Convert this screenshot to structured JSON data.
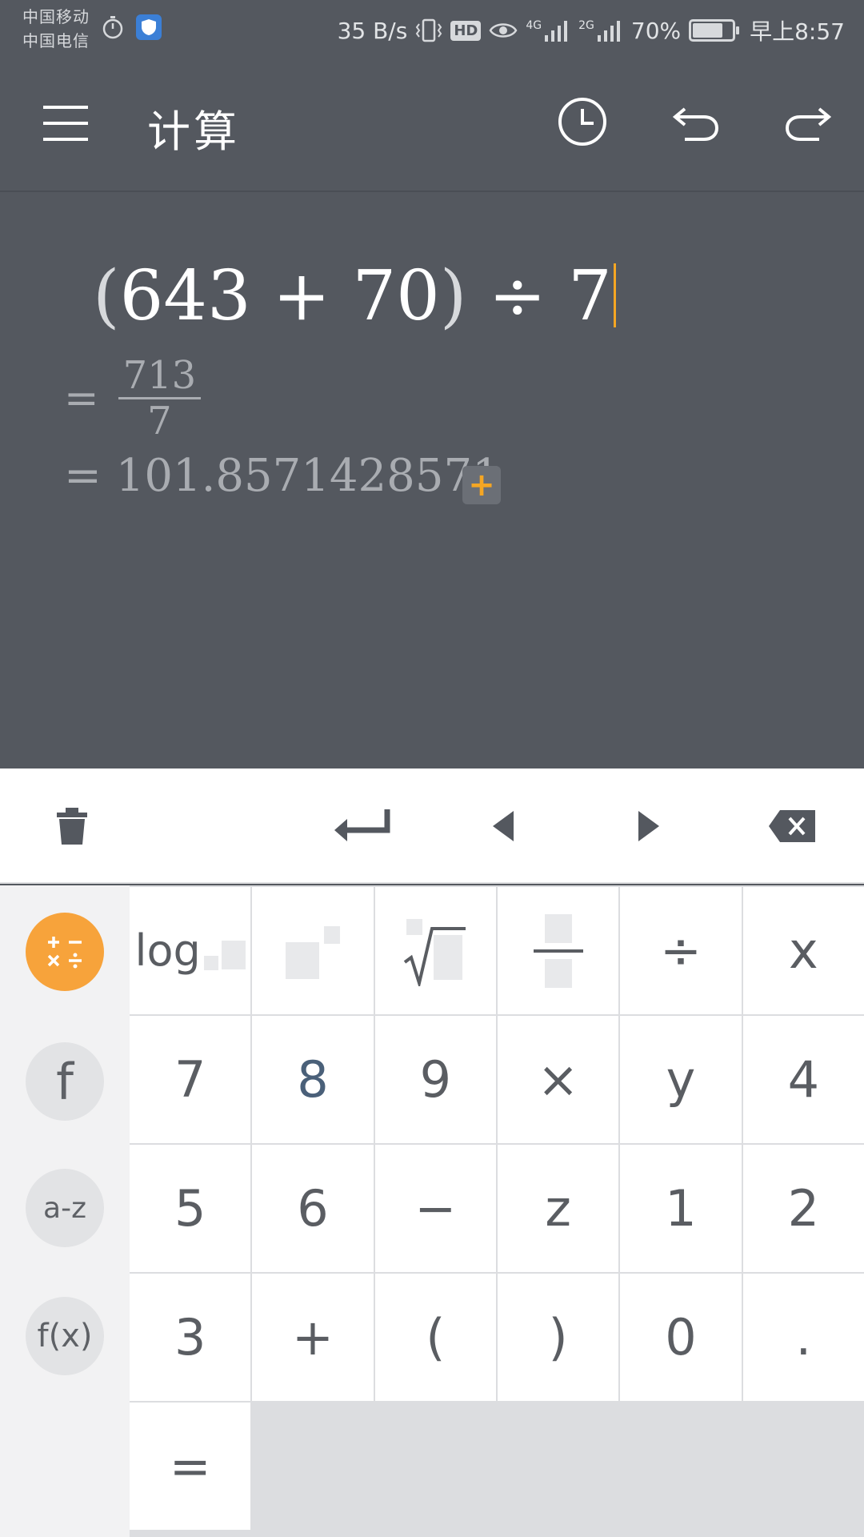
{
  "status_bar": {
    "carrier_1": "中国移动",
    "carrier_2": "中国电信",
    "net_speed": "35 B/s",
    "hd": "HD",
    "net_1": "4G",
    "net_2": "2G",
    "battery_pct": "70%",
    "time": "早上8:57"
  },
  "toolbar": {
    "title": "计算",
    "icons": [
      "menu-icon",
      "history-icon",
      "undo-icon",
      "redo-icon"
    ]
  },
  "display": {
    "expr_open": "(",
    "expr_body": "643 + 70",
    "expr_close": ")",
    "expr_tail": " ÷ 7",
    "eq_symbol": "=",
    "fraction_num": "713",
    "fraction_den": "7",
    "decimal_result": "= 101.8571428571",
    "add_label": "+"
  },
  "tools_row": {
    "icons": [
      "trash-icon",
      "enter-icon",
      "cursor-left-icon",
      "cursor-right-icon",
      "backspace-icon"
    ]
  },
  "side_modes": [
    {
      "label": "+−×÷",
      "icon": "arithmetic-mode-icon",
      "active": true
    },
    {
      "label": "f",
      "icon": "function-mode-icon",
      "active": false
    },
    {
      "label": "a-z",
      "icon": "letters-mode-icon",
      "active": false
    },
    {
      "label": "f(x)",
      "icon": "fx-mode-icon",
      "active": false
    }
  ],
  "keys": {
    "row1": [
      "log",
      "power",
      "root",
      "fraction",
      "÷"
    ],
    "row2": [
      "x",
      "7",
      "8",
      "9",
      "×"
    ],
    "row3": [
      "y",
      "4",
      "5",
      "6",
      "−"
    ],
    "row4": [
      "z",
      "1",
      "2",
      "3",
      "+"
    ],
    "row5": [
      "(",
      ")",
      "0",
      ".",
      "="
    ]
  },
  "colors": {
    "dark_bg": "#54585f",
    "accent": "#f5a623",
    "key_text": "#5a5d62"
  }
}
